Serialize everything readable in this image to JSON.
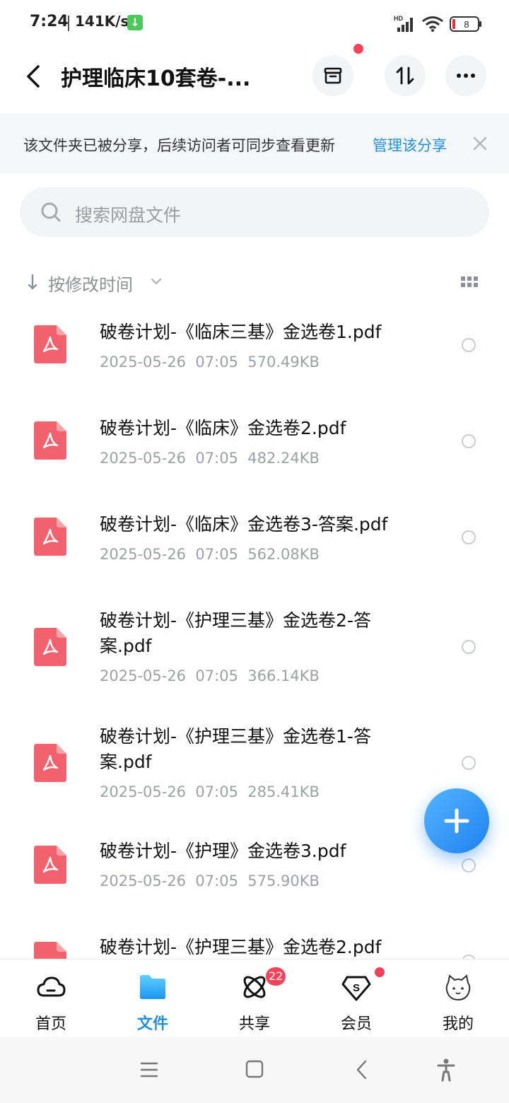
{
  "status_bar": {
    "time": "7:24",
    "speed": "141K/s",
    "download_icon": "download-arrow-icon",
    "network_label": "HD",
    "battery": "8"
  },
  "header": {
    "title": "护理临床10套卷-...",
    "back_icon": "back-arrow-icon",
    "archive_icon": "archive-box-icon",
    "sort_toggle_icon": "sort-arrows-icon",
    "more_icon": "more-dots-icon"
  },
  "share_banner": {
    "text": "该文件夹已被分享，后续访问者可同步查看更新",
    "link": "管理该分享"
  },
  "search": {
    "placeholder": "搜索网盘文件"
  },
  "sort": {
    "label": "按修改时间"
  },
  "files": [
    {
      "name": "破卷计划-《临床三基》金选卷1.pdf",
      "date": "2025-05-26",
      "time": "07:05",
      "size": "570.49KB"
    },
    {
      "name": "破卷计划-《临床》金选卷2.pdf",
      "date": "2025-05-26",
      "time": "07:05",
      "size": "482.24KB"
    },
    {
      "name": "破卷计划-《临床》金选卷3-答案.pdf",
      "date": "2025-05-26",
      "time": "07:05",
      "size": "562.08KB"
    },
    {
      "name": "破卷计划-《护理三基》金选卷2-答案.pdf",
      "date": "2025-05-26",
      "time": "07:05",
      "size": "366.14KB"
    },
    {
      "name": "破卷计划-《护理三基》金选卷1-答案.pdf",
      "date": "2025-05-26",
      "time": "07:05",
      "size": "285.41KB"
    },
    {
      "name": "破卷计划-《护理》金选卷3.pdf",
      "date": "2025-05-26",
      "time": "07:05",
      "size": "575.90KB"
    },
    {
      "name": "破卷计划-《护理三基》金选卷2.pdf",
      "date": "",
      "time": "",
      "size": ""
    }
  ],
  "bottom_nav": [
    {
      "label": "首页",
      "icon": "cloud-home-icon",
      "active": false
    },
    {
      "label": "文件",
      "icon": "folder-icon",
      "active": true
    },
    {
      "label": "共享",
      "icon": "share-atom-icon",
      "active": false,
      "badge": "22"
    },
    {
      "label": "会员",
      "icon": "vip-diamond-icon",
      "active": false,
      "dot": true
    },
    {
      "label": "我的",
      "icon": "avatar-cat-icon",
      "active": false
    }
  ],
  "colors": {
    "accent": "#1f8fe0",
    "pdf_red": "#f2616e",
    "badge_red": "#f5425a"
  }
}
